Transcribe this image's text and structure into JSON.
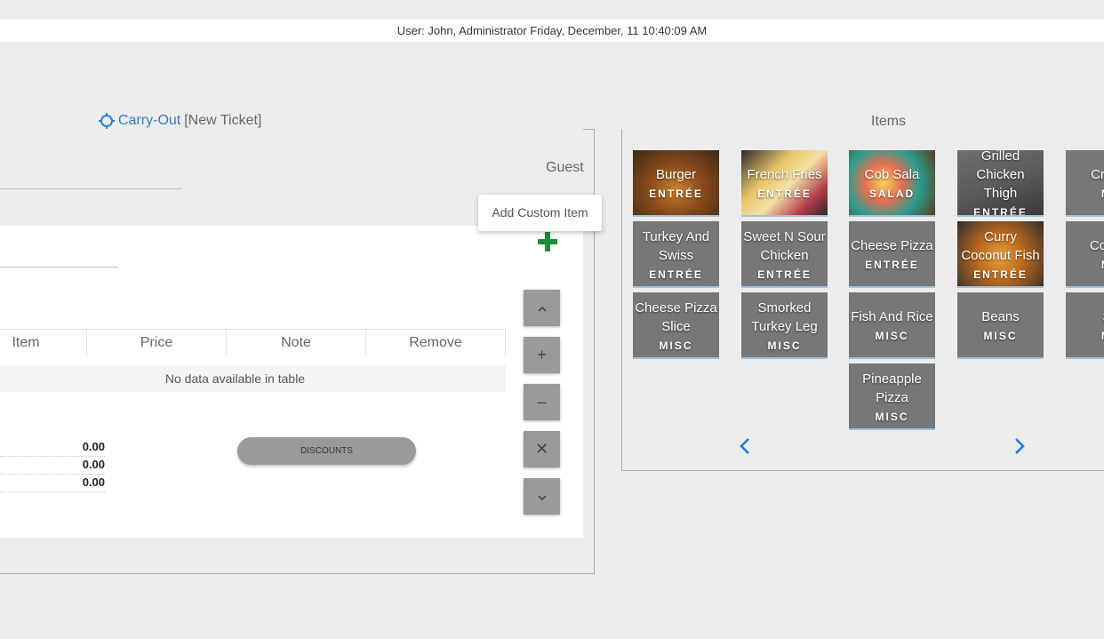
{
  "header": {
    "user_info": "User: John, Administrator Friday, December, 11 10:40:09 AM"
  },
  "ticket": {
    "order_type": "Carry-Out",
    "ticket_label": "[New Ticket]",
    "guest_label": "Guest",
    "add_custom_tooltip": "Add Custom Item",
    "columns": [
      "Item",
      "Price",
      "Note",
      "Remove"
    ],
    "empty_message": "No data available in table",
    "totals": [
      "0.00",
      "0.00",
      "0.00"
    ],
    "discounts_label": "DISCOUNTS"
  },
  "side_buttons": [
    {
      "name": "scroll-up-button",
      "glyph": "⌃"
    },
    {
      "name": "increase-button",
      "glyph": "+"
    },
    {
      "name": "decrease-button",
      "glyph": "–"
    },
    {
      "name": "delete-button",
      "glyph": "✕"
    },
    {
      "name": "scroll-down-button",
      "glyph": "⌄"
    }
  ],
  "items_panel": {
    "title": "Items",
    "tiles": [
      {
        "name": "Burger",
        "category": "ENTRÉE",
        "image": "burger"
      },
      {
        "name": "Turkey And Swiss",
        "category": "ENTRÉE",
        "image": ""
      },
      {
        "name": "Cheese Pizza Slice",
        "category": "MISC",
        "image": ""
      },
      {
        "name": "French Fries",
        "category": "ENTRÉE",
        "image": "fries"
      },
      {
        "name": "Sweet N Sour Chicken",
        "category": "ENTRÉE",
        "image": ""
      },
      {
        "name": "Smorked Turkey Leg",
        "category": "MISC",
        "image": ""
      },
      {
        "name": "Cob Sala",
        "category": "SALAD",
        "image": "salad"
      },
      {
        "name": "Cheese Pizza",
        "category": "ENTRÉE",
        "image": ""
      },
      {
        "name": "Fish And Rice",
        "category": "MISC",
        "image": ""
      },
      {
        "name": "Pineapple Pizza",
        "category": "MISC",
        "image": ""
      },
      {
        "name": "Grilled Chicken Thigh",
        "category": "ENTRÉE",
        "image": "chicken"
      },
      {
        "name": "Curry Coconut Fish",
        "category": "ENTRÉE",
        "image": "curry"
      },
      {
        "name": "Beans",
        "category": "MISC",
        "image": ""
      },
      {
        "name": "Crab I",
        "category": "MI",
        "image": ""
      },
      {
        "name": "Cocoa",
        "category": "MI",
        "image": ""
      },
      {
        "name": "St",
        "category": "MI",
        "image": ""
      }
    ]
  }
}
